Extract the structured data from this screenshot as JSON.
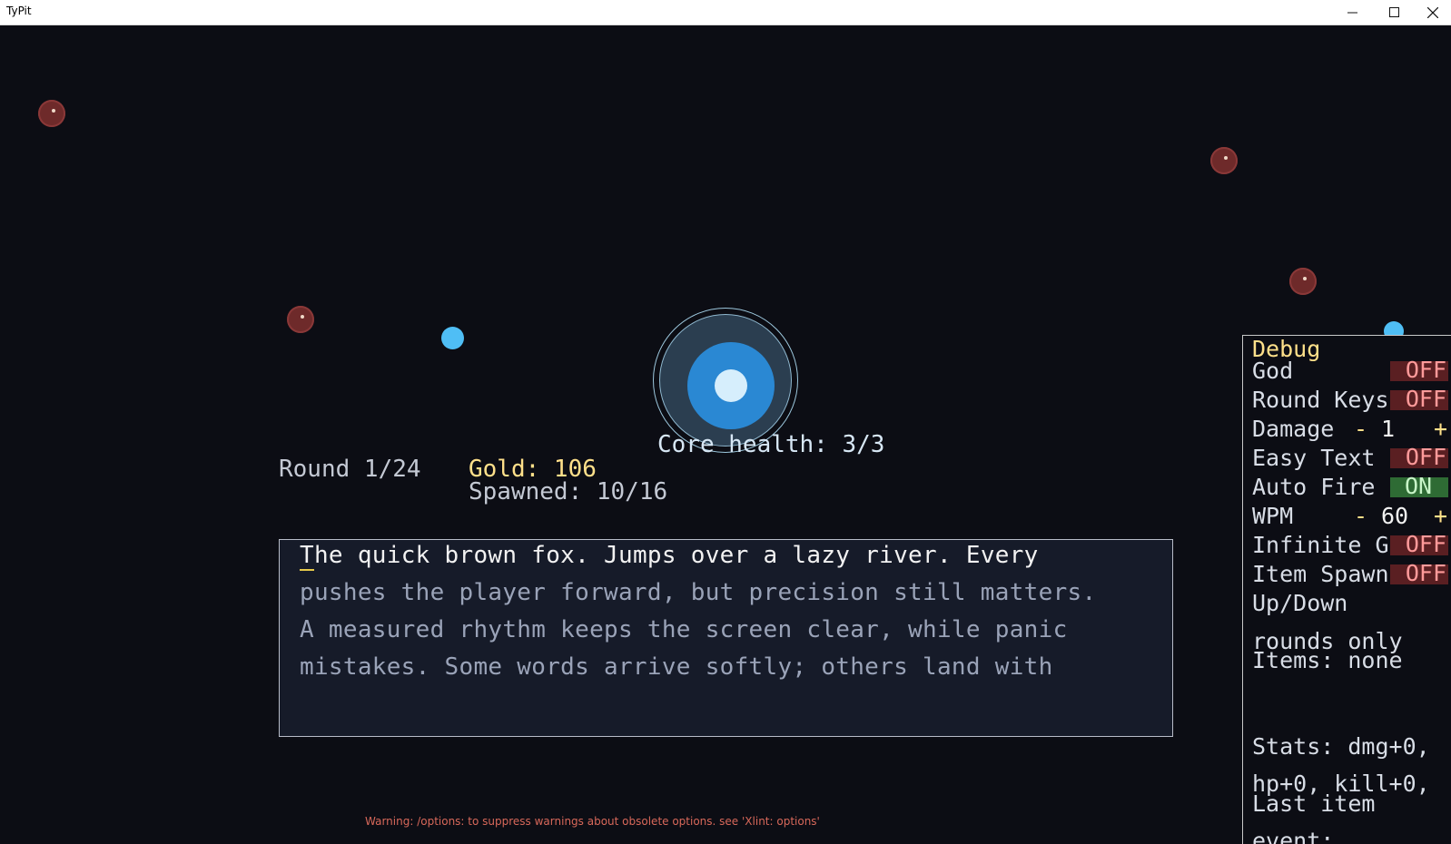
{
  "window": {
    "title": "TyPit"
  },
  "hud": {
    "round": "Round 1/24",
    "gold": "Gold: 106",
    "spawned": "Spawned: 10/16",
    "core_health": "Core health: 3/3"
  },
  "typing": {
    "cursor_char": "T",
    "line1_rest": "he quick brown fox. Jumps over a lazy river. Every",
    "line2": "pushes the player forward, but precision still matters.",
    "line3": "A measured rhythm keeps the screen clear, while panic",
    "line4": "mistakes. Some words arrive softly; others land with"
  },
  "debug": {
    "title": "Debug",
    "god_label": "God",
    "god_value": "OFF",
    "round_keys_label": "Round Keys",
    "round_keys_value": "OFF",
    "damage_label": "Damage",
    "damage_minus": "-",
    "damage_value": "1",
    "damage_plus": "+",
    "easy_text_label": "Easy Text",
    "easy_text_value": "OFF",
    "auto_fire_label": "Auto Fire",
    "auto_fire_value": "ON",
    "wpm_label": "WPM",
    "wpm_minus": "-",
    "wpm_value": "60",
    "wpm_plus": "+",
    "infinite_gold_label": "Infinite Gold",
    "infinite_gold_value": "OFF",
    "item_spawns_label": "Item Spawns",
    "item_spawns_value": "OFF",
    "updown_label": "Up/Down",
    "rounds_only": "rounds only",
    "items": "Items: none",
    "stats_line1": "Stats: dmg+0,",
    "stats_line2": "hp+0, kill+0,",
    "last_item": "Last item",
    "event": "event:"
  },
  "console_warning": "Warning: /options: to suppress warnings about obsolete options. see 'Xlint: options'",
  "colors": {
    "background": "#0c0d14",
    "enemy": "#6e2a2a",
    "projectile": "#4fbef5",
    "core": "#2a88d3",
    "gold": "#ffe08a",
    "toggle_off": "#5a1f22",
    "toggle_on": "#2e6b34"
  }
}
